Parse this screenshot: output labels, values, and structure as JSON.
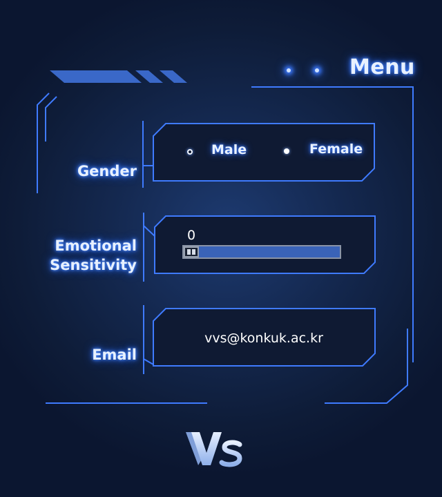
{
  "menu": {
    "label": "Menu"
  },
  "form": {
    "gender": {
      "label": "Gender",
      "options": [
        {
          "label": "Male",
          "selected": false
        },
        {
          "label": "Female",
          "selected": true
        }
      ]
    },
    "sensitivity": {
      "label_line1": "Emotional",
      "label_line2": "Sensitivity",
      "value": "0",
      "fill_fraction": 0
    },
    "email": {
      "label": "Email",
      "value": "vvs@konkuk.ac.kr"
    }
  },
  "logo": {
    "text": "Vs"
  },
  "colors": {
    "background": "#14284f",
    "line": "#3f7bff",
    "panel": "#0f1a33",
    "text_glow": "#2f6cf0",
    "slider_track": "#3a63b8"
  },
  "icons": [
    "menu-dot-icon",
    "radio-unchecked-icon",
    "radio-checked-icon",
    "slider-thumb-icon",
    "vs-logo-icon"
  ]
}
